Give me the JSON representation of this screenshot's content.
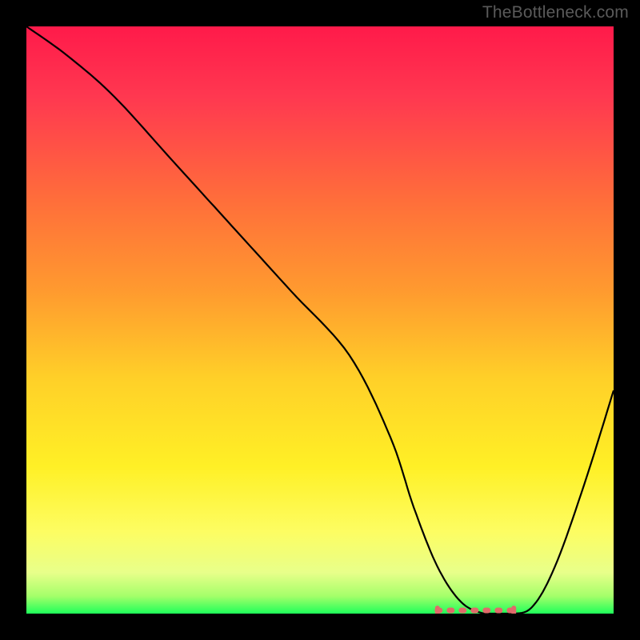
{
  "watermark": "TheBottleneck.com",
  "chart_data": {
    "type": "line",
    "title": "",
    "xlabel": "",
    "ylabel": "",
    "xlim": [
      0,
      100
    ],
    "ylim": [
      0,
      100
    ],
    "x": [
      0,
      7,
      15,
      25,
      35,
      45,
      55,
      62,
      66,
      70,
      74,
      78,
      82,
      86,
      90,
      95,
      100
    ],
    "values": [
      100,
      95,
      88,
      77,
      66,
      55,
      44,
      30,
      18,
      8,
      2,
      0,
      0,
      1,
      8,
      22,
      38
    ],
    "gradient_stops": [
      {
        "offset": 0.0,
        "color": "#ff1a4a"
      },
      {
        "offset": 0.12,
        "color": "#ff3850"
      },
      {
        "offset": 0.3,
        "color": "#ff6f3a"
      },
      {
        "offset": 0.45,
        "color": "#ff9a2f"
      },
      {
        "offset": 0.6,
        "color": "#ffd028"
      },
      {
        "offset": 0.75,
        "color": "#fff026"
      },
      {
        "offset": 0.86,
        "color": "#fdfd62"
      },
      {
        "offset": 0.93,
        "color": "#e8ff8a"
      },
      {
        "offset": 0.97,
        "color": "#a5ff6a"
      },
      {
        "offset": 1.0,
        "color": "#1eff5a"
      }
    ],
    "marker": {
      "x_range": [
        70,
        83
      ],
      "y": 0,
      "color": "#e06a6a"
    }
  }
}
